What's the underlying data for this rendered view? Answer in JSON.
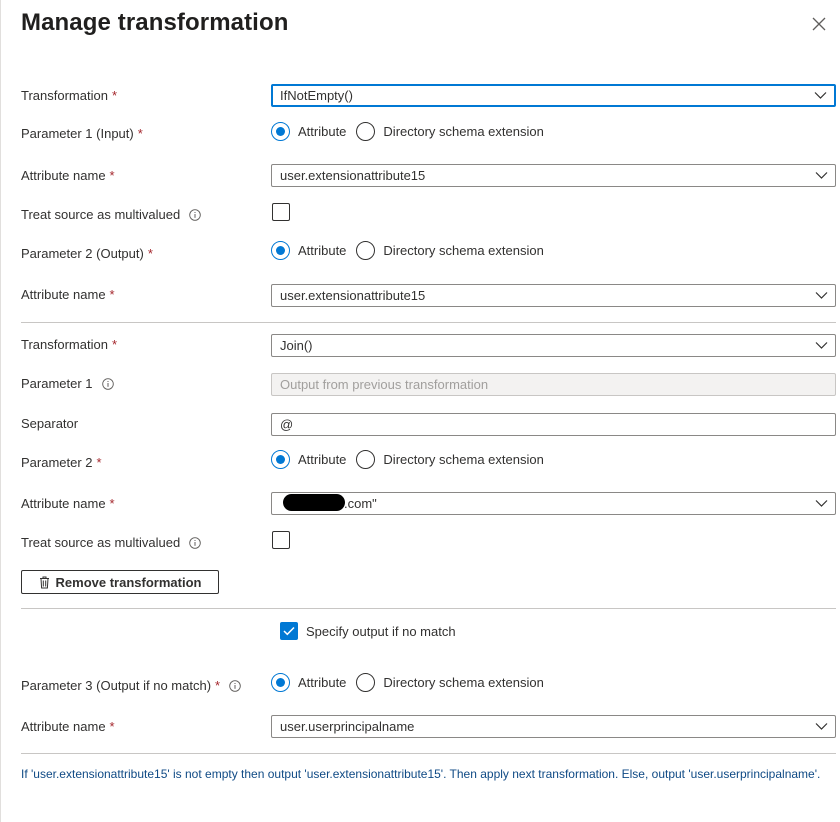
{
  "title": "Manage transformation",
  "required_mark": "*",
  "radio_options": {
    "attribute": "Attribute",
    "directory_schema_extension": "Directory schema extension"
  },
  "section1": {
    "transformation_label": "Transformation",
    "transformation_value": "IfNotEmpty()",
    "param1_label": "Parameter 1 (Input)",
    "attr1_label": "Attribute name",
    "attr1_value": "user.extensionattribute15",
    "multivalued_label": "Treat source as multivalued",
    "param2_label": "Parameter 2 (Output)",
    "attr2_label": "Attribute name",
    "attr2_value": "user.extensionattribute15"
  },
  "section2": {
    "transformation_label": "Transformation",
    "transformation_value": "Join()",
    "param1_label": "Parameter 1",
    "param1_placeholder": "Output from previous transformation",
    "separator_label": "Separator",
    "separator_value": "@",
    "param2_label": "Parameter 2",
    "attr_label": "Attribute name",
    "attr_value_suffix": ".com\"",
    "multivalued_label": "Treat source as multivalued",
    "remove_button": "Remove transformation"
  },
  "no_match": {
    "specify_label": "Specify output if no match",
    "param3_label": "Parameter 3 (Output if no match)",
    "attr_label": "Attribute name",
    "attr_value": "user.userprincipalname"
  },
  "summary": "If 'user.extensionattribute15' is not empty then output 'user.extensionattribute15'. Then apply next transformation. Else, output 'user.userprincipalname'.",
  "colors": {
    "accent": "#0078d4",
    "required": "#a4262c",
    "summary_text": "#0f4a85"
  }
}
